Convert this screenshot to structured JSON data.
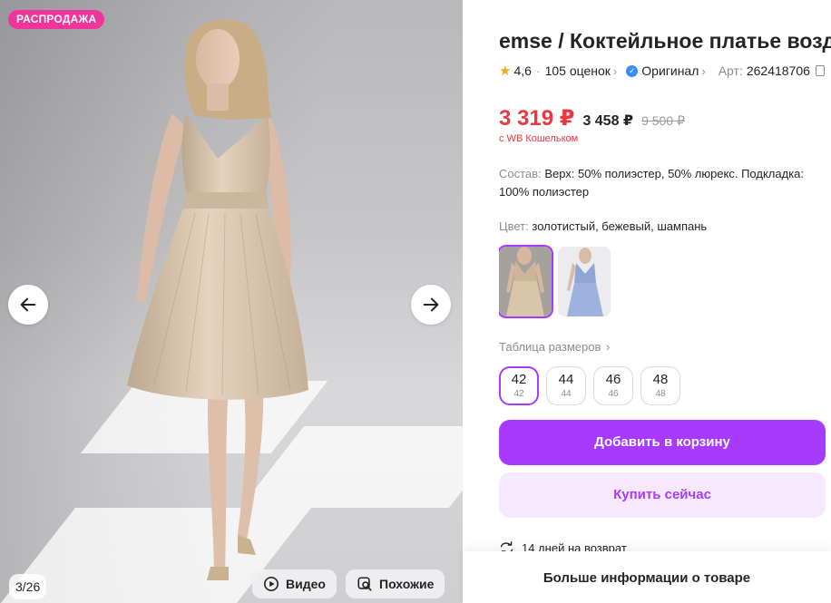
{
  "gallery": {
    "sale_badge": "РАСПРОДАЖА",
    "counter": "3/26",
    "video_label": "Видео",
    "similar_label": "Похожие",
    "prev_icon": "arrow-left-icon",
    "next_icon": "arrow-right-icon"
  },
  "product": {
    "title": "emse / Коктейльное платье возд",
    "rating": "4,6",
    "reviews": "105 оценок",
    "original_label": "Оригинал",
    "article_label": "Арт:",
    "article": "262418706"
  },
  "price": {
    "main": "3 319 ₽",
    "second": "3 458 ₽",
    "old": "9 500 ₽",
    "wallet_note": "с WB Кошельком"
  },
  "composition": {
    "label": "Состав:",
    "value": "Верх: 50% полиэстер, 50% люрекс. Подкладка: 100% полиэстер"
  },
  "color": {
    "label": "Цвет:",
    "value": "золотистый, бежевый, шампань"
  },
  "sizes": {
    "table_label": "Таблица размеров",
    "items": [
      {
        "main": "42",
        "sub": "42",
        "selected": true
      },
      {
        "main": "44",
        "sub": "44",
        "selected": false
      },
      {
        "main": "46",
        "sub": "46",
        "selected": false
      },
      {
        "main": "48",
        "sub": "48",
        "selected": false
      }
    ]
  },
  "actions": {
    "add_to_cart": "Добавить в корзину",
    "buy_now": "Купить сейчас"
  },
  "returns": "14 дней на возврат",
  "more_info": "Больше информации о товаре",
  "colors": {
    "accent": "#a73afd",
    "price_red": "#e9383f",
    "sale_pink": "#f0359a",
    "buy_bg": "#f6e8fe"
  }
}
